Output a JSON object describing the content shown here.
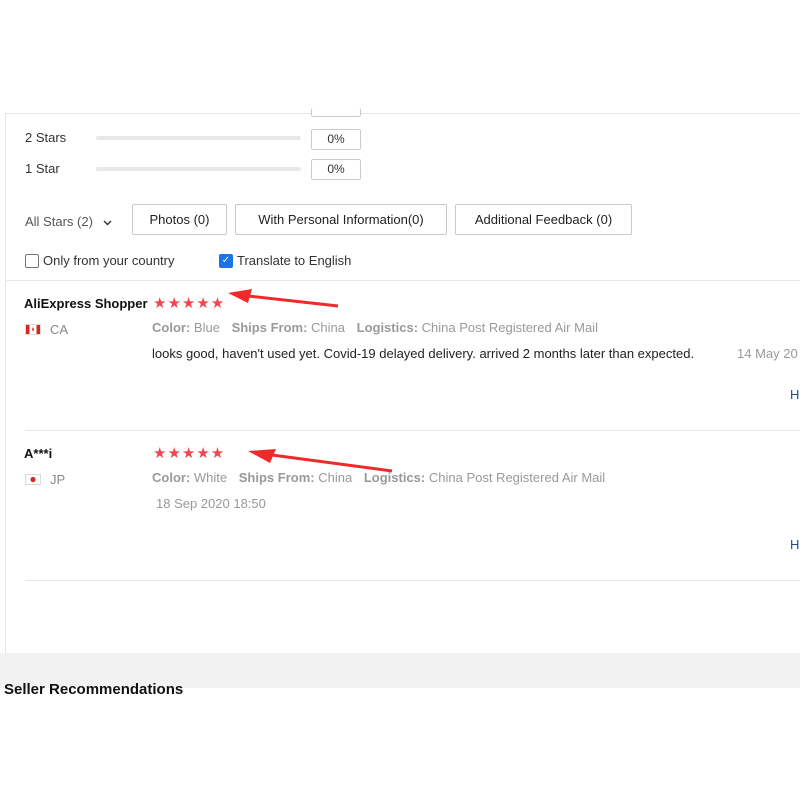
{
  "rating_breakdown": [
    {
      "label": "2 Stars",
      "percent": "0%"
    },
    {
      "label": "1 Star",
      "percent": "0%"
    }
  ],
  "filters": {
    "all_stars": "All Stars (2)",
    "photos": "Photos (0)",
    "personal_info": "With Personal Information(0)",
    "additional_feedback": "Additional Feedback (0)"
  },
  "options": {
    "only_country": "Only from your country",
    "only_country_checked": false,
    "translate": "Translate to English",
    "translate_checked": true
  },
  "reviews": [
    {
      "name": "AliExpress Shopper",
      "country": "CA",
      "stars": "★★★★★",
      "rating": 5,
      "color_label": "Color:",
      "color_value": "Blue",
      "ships_label": "Ships From:",
      "ships_value": "China",
      "logistics_label": "Logistics:",
      "logistics_value": "China Post Registered Air Mail",
      "text": "looks good, haven't used yet. Covid-19 delayed delivery. arrived 2 months later than expected.",
      "date": "14 May 20",
      "helpful": "H"
    },
    {
      "name": "A***i",
      "country": "JP",
      "stars": "★★★★★",
      "rating": 5,
      "color_label": "Color:",
      "color_value": "White",
      "ships_label": "Ships From:",
      "ships_value": "China",
      "logistics_label": "Logistics:",
      "logistics_value": "China Post Registered Air Mail",
      "text": "",
      "date": "18 Sep 2020 18:50",
      "helpful": "H"
    }
  ],
  "section_below": {
    "title": "Seller Recommendations"
  },
  "colors": {
    "star": "#f0474f",
    "arrow": "#ee2a2a",
    "link": "#1a4e8a",
    "checkbox": "#1a73e8"
  }
}
